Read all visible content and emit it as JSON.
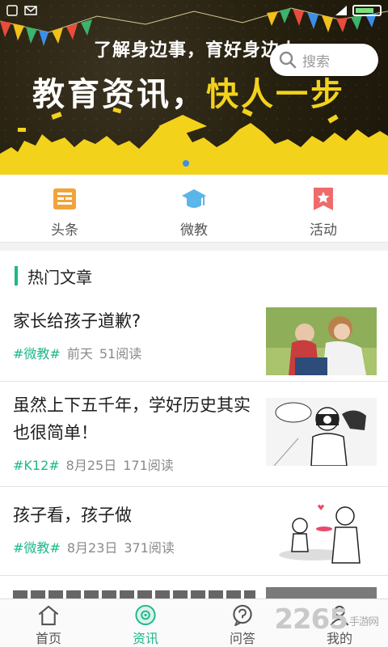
{
  "banner": {
    "subtitle": "了解身边事，育好身边人",
    "title_white_1": "教育资讯",
    "title_white_2": "，",
    "title_yellow": "快人一步"
  },
  "search": {
    "placeholder": "搜索"
  },
  "categories": [
    {
      "label": "头条",
      "icon": "newspaper-icon"
    },
    {
      "label": "微教",
      "icon": "graduation-cap-icon"
    },
    {
      "label": "活动",
      "icon": "star-ribbon-icon"
    }
  ],
  "hot": {
    "title": "热门文章",
    "articles": [
      {
        "title": "家长给孩子道歉?",
        "tag": "#微教#",
        "date": "前天",
        "reads": "51阅读"
      },
      {
        "title": "虽然上下五千年，学好历史其实也很简单！",
        "tag": "#K12#",
        "date": "8月25日",
        "reads": "171阅读"
      },
      {
        "title": "孩子看，孩子做",
        "tag": "#微教#",
        "date": "8月23日",
        "reads": "371阅读"
      }
    ]
  },
  "tabs": [
    {
      "label": "首页",
      "icon": "home-icon",
      "active": false
    },
    {
      "label": "资讯",
      "icon": "news-disc-icon",
      "active": true
    },
    {
      "label": "问答",
      "icon": "question-icon",
      "active": false
    },
    {
      "label": "我的",
      "icon": "user-icon",
      "active": false
    }
  ],
  "watermark": {
    "main": "2265",
    "sub": "手游网"
  },
  "colors": {
    "accent": "#1db88a",
    "banner_yellow": "#f3d21c",
    "category_orange": "#f2a33a",
    "category_blue": "#5bb6e8",
    "category_red": "#ef6b6b"
  }
}
